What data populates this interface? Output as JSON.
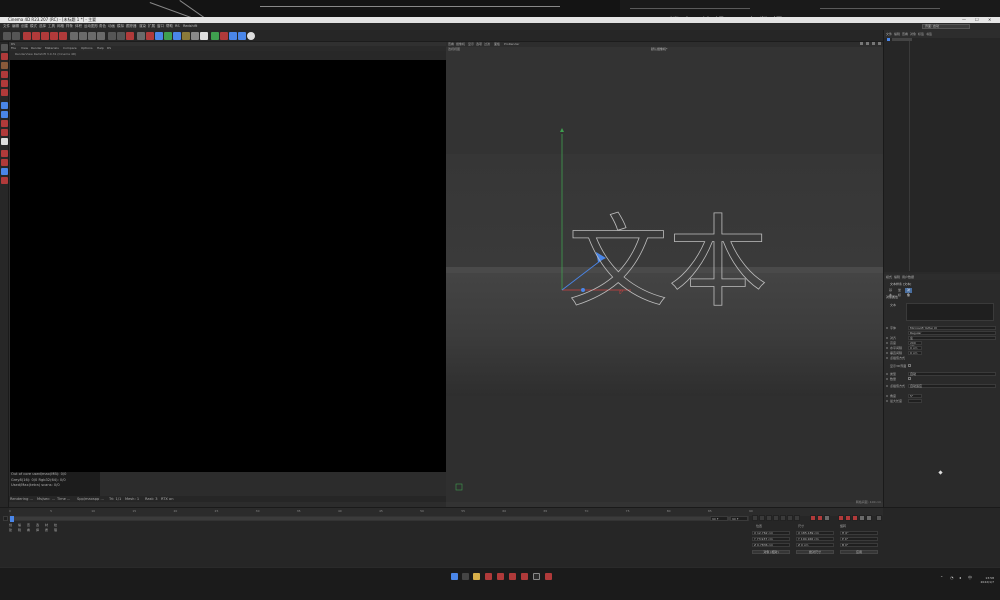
{
  "window": {
    "title": "Cinema 4D R23.207 (RC) - [未标题 1 *] - 主要",
    "minimize": "—",
    "maximize": "☐",
    "close": "✕"
  },
  "background": {
    "ghost_text": "口 锁定  编辑  用户数据"
  },
  "menubar": {
    "items": [
      "文件",
      "编辑",
      "创建",
      "模式",
      "选择",
      "工具",
      "网格",
      "样条",
      "体积",
      "运动图形",
      "角色",
      "动画",
      "模拟",
      "跟踪器",
      "渲染",
      "扩展",
      "窗口",
      "帮助",
      "RS",
      "Redshift"
    ],
    "layout_label": "界面: 启动"
  },
  "render_view": {
    "header": "RS",
    "menu": [
      "File",
      "View",
      "Render",
      "Materials",
      "Compare",
      "Options",
      "Help",
      "RS"
    ],
    "title_hint": "RenderView Redshift 3.0.31 (Cinema 4D)",
    "info_lines": [
      "Out of core used/max(MB): 0/0",
      "Grey8(16): 0/0       Rgb32(64): 0/0",
      "Used/Max(tetra) scans: 0/0"
    ],
    "status": [
      "Rendering ...",
      "Ms/sec: ...",
      "Time ...",
      "Spp/maxspp ...",
      "Tri: 1/1",
      "Mesh: 1",
      "Rast: 3",
      "RTX on"
    ]
  },
  "viewport": {
    "menu": [
      "查看",
      "摄像机",
      "显示",
      "选项",
      "过滤",
      "面板",
      "ProRender"
    ],
    "view_label": "透视视图",
    "camera_label": "默认摄像机*",
    "text_object": "文本",
    "axis_label": "0°",
    "footer": "网格间距: 100 cm"
  },
  "object_manager": {
    "menu": [
      "文件",
      "编辑",
      "查看",
      "对象",
      "标签",
      "书签"
    ]
  },
  "attributes": {
    "menu": [
      "模式",
      "编辑",
      "用户数据"
    ],
    "object_title": "文本样条 [文本]",
    "tabs": [
      "基本",
      "坐标",
      "对象"
    ],
    "section": "对象属性",
    "text_label": "文本",
    "properties": [
      {
        "label": "字体",
        "value": "Microsoft YaHei UI"
      },
      {
        "label": "",
        "value": "Regular"
      },
      {
        "label": "对齐",
        "value": "左"
      },
      {
        "label": "高度",
        "value": "200 cm"
      },
      {
        "label": "水平间隔",
        "value": "0 cm"
      },
      {
        "label": "垂直间隔",
        "value": "0 cm"
      },
      {
        "label": "点插值方式",
        "value": ""
      },
      {
        "label": "显示3D界面",
        "value": ""
      },
      {
        "label": "类型",
        "value": "自动"
      },
      {
        "label": "数量",
        "value": ""
      },
      {
        "label": "点插值方式",
        "value": "自动适应"
      },
      {
        "label": "角度",
        "value": "5°"
      },
      {
        "label": "最大长度",
        "value": ""
      }
    ]
  },
  "timeline": {
    "ticks": [
      "0",
      "5",
      "10",
      "15",
      "20",
      "25",
      "30",
      "35",
      "40",
      "45",
      "50",
      "55",
      "60",
      "65",
      "70",
      "75",
      "80",
      "85",
      "90"
    ],
    "start_frame": "0 F",
    "end_frame": "90 F",
    "current_frame": "90 F",
    "menu": [
      "创建",
      "编辑",
      "查看",
      "选择",
      "材质",
      "纹理"
    ],
    "playhead_fraction": 0.0
  },
  "coordinates": {
    "headers": [
      "位置",
      "尺寸",
      "旋转"
    ],
    "rows": [
      [
        "X  12.762 cm",
        "X  185.189 cm",
        "H  0°"
      ],
      [
        "Y  73.937 cm",
        "Y  100.166 cm",
        "P  0°"
      ],
      [
        "Z  0.7836 cm",
        "Z  0 cm",
        "B  0°"
      ]
    ],
    "buttons": [
      "对象 (相对)",
      "绝对尺寸",
      "应用"
    ]
  },
  "taskbar": {
    "time": "13:58",
    "date": "2022/1/7",
    "lang": "中"
  },
  "colors": {
    "accent": "#4a86e8",
    "text_outline": "#bdbdbd",
    "axis_green": "#3f9f4f",
    "axis_red": "#d04040",
    "axis_blue": "#4a86e8"
  }
}
